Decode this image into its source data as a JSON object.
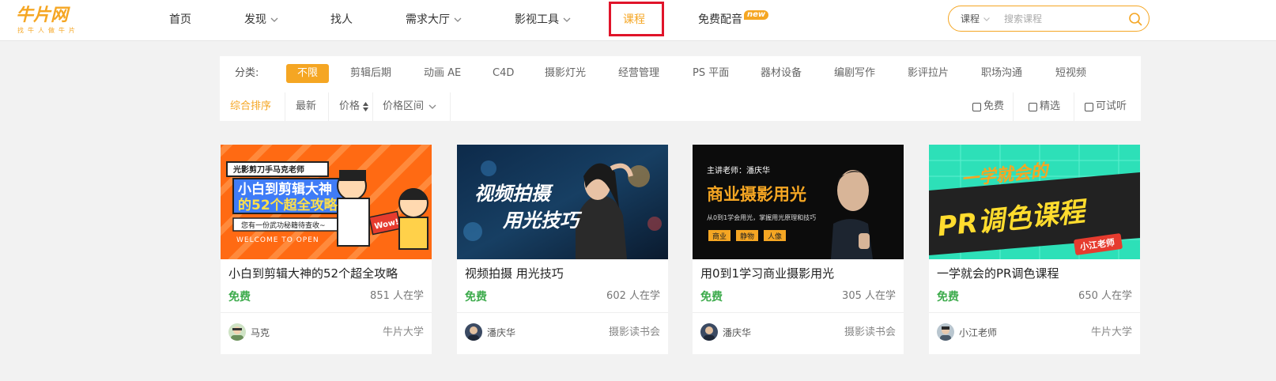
{
  "header": {
    "logo_main": "牛片网",
    "logo_sub": "找牛人做牛片",
    "nav": [
      {
        "label": "首页"
      },
      {
        "label": "发现"
      },
      {
        "label": "找人"
      },
      {
        "label": "需求大厅"
      },
      {
        "label": "影视工具"
      },
      {
        "label": "课程"
      },
      {
        "label": "免费配音"
      }
    ],
    "new_badge": "new",
    "search": {
      "type": "课程",
      "placeholder": "搜索课程"
    }
  },
  "filter": {
    "category_label": "分类:",
    "categories": [
      "不限",
      "剪辑后期",
      "动画 AE",
      "C4D",
      "摄影灯光",
      "经营管理",
      "PS 平面",
      "器材设备",
      "编剧写作",
      "影评拉片",
      "职场沟通",
      "短视频"
    ],
    "sorts": [
      "综合排序",
      "最新",
      "价格",
      "价格区间"
    ],
    "checkboxes": [
      "免费",
      "精选",
      "可试听"
    ]
  },
  "courses": [
    {
      "title": "小白到剪辑大神的52个超全攻略",
      "price": "免费",
      "learners": "851 人在学",
      "author": "马克",
      "org": "牛片大学",
      "thumb": {
        "tag": "光影剪刀手马克老师",
        "line1": "小白到剪辑大神",
        "line2": "的52个超全攻略",
        "line3": "您有一份武功秘籍待查收~",
        "line4": "WELCOME TO OPEN",
        "wow": "Wow!"
      }
    },
    {
      "title": "视频拍摄 用光技巧",
      "price": "免费",
      "learners": "602 人在学",
      "author": "潘庆华",
      "org": "摄影读书会",
      "thumb": {
        "line1": "视频拍摄",
        "line2": "用光技巧"
      }
    },
    {
      "title": "用0到1学习商业摄影用光",
      "price": "免费",
      "learners": "305 人在学",
      "author": "潘庆华",
      "org": "摄影读书会",
      "thumb": {
        "tag": "主讲老师：潘庆华",
        "line1": "商业摄影用光",
        "line2": "从0到1学会用光，掌握用光原理和技巧",
        "chips": [
          "商业",
          "静物",
          "人像"
        ]
      }
    },
    {
      "title": "一学就会的PR调色课程",
      "price": "免费",
      "learners": "650 人在学",
      "author": "小江老师",
      "org": "牛片大学",
      "thumb": {
        "line1": "一学就会的",
        "line2": "PR调色课程",
        "badge": "小江老师"
      }
    }
  ],
  "colors": {
    "accent": "#f5a623",
    "free_green": "#3dab4c",
    "highlight_border": "#e0142a"
  }
}
